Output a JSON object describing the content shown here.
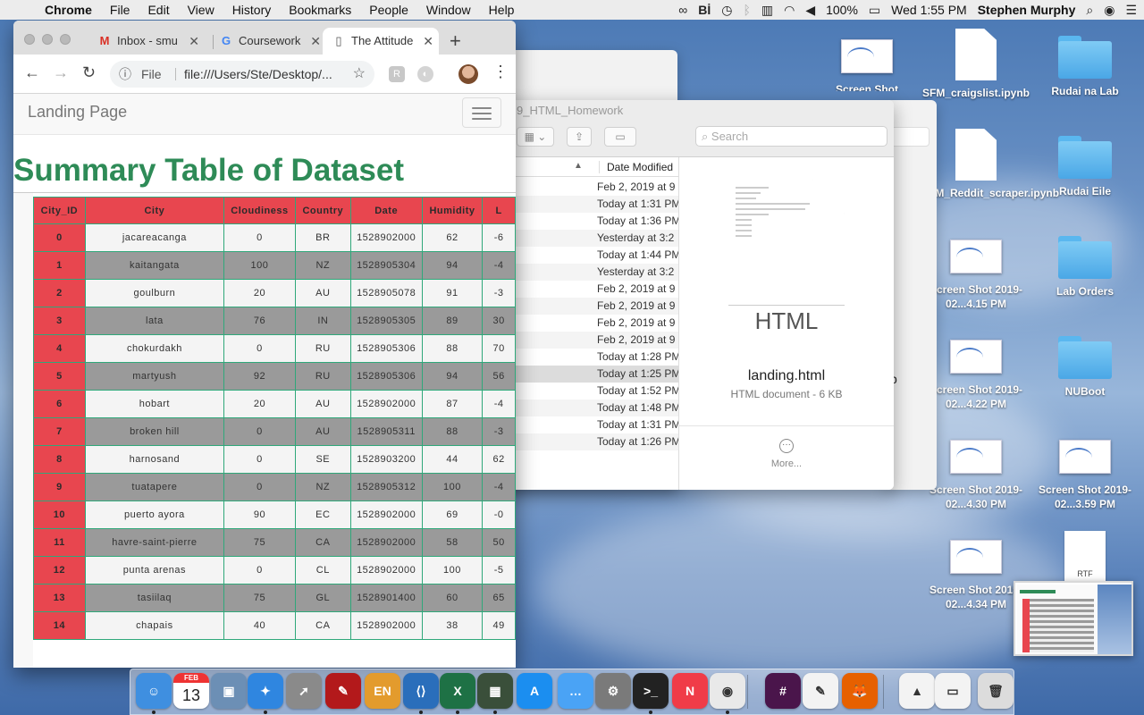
{
  "menubar": {
    "app": "Chrome",
    "items": [
      "File",
      "Edit",
      "View",
      "History",
      "Bookmarks",
      "People",
      "Window",
      "Help"
    ],
    "battery": "100%",
    "clock": "Wed 1:55 PM",
    "user": "Stephen Murphy"
  },
  "desktop": {
    "icons": [
      {
        "label": "Screen Shot",
        "kind": "screenshot"
      },
      {
        "label": "SFM_craigslist.ipynb",
        "kind": "document"
      },
      {
        "label": "Rudai na Lab",
        "kind": "folder"
      },
      {
        "label": "SFM_Reddit_scraper.ipynb",
        "kind": "document"
      },
      {
        "label": "Rudai Eile",
        "kind": "folder"
      },
      {
        "label": "Screen Shot 2019-02...4.15 PM",
        "kind": "screenshot"
      },
      {
        "label": "Lab Orders",
        "kind": "folder"
      },
      {
        "label": "Screen Shot 2019-02...4.22 PM",
        "kind": "screenshot"
      },
      {
        "label": "NUBoot",
        "kind": "folder"
      },
      {
        "label": "Screen Shot 2019-02...4.30 PM",
        "kind": "screenshot"
      },
      {
        "label": "Screen Shot 2019-02...3.59 PM",
        "kind": "screenshot"
      },
      {
        "label": "Screen Shot 2019-02...4.34 PM",
        "kind": "screenshot"
      },
      {
        "label": "RTF",
        "kind": "rtf"
      }
    ]
  },
  "finder": {
    "title": "9_HTML_Homework",
    "search_placeholder": "Search",
    "column_header": "Date Modified",
    "dates": [
      "Feb 2, 2019 at 9",
      "Today at 1:31 PM",
      "Today at 1:36 PM",
      "Yesterday at 3:2",
      "Today at 1:44 PM",
      "Yesterday at 3:2",
      "Feb 2, 2019 at 9",
      "Feb 2, 2019 at 9",
      "Feb 2, 2019 at 9",
      "Feb 2, 2019 at 9",
      "Today at 1:28 PM",
      "Today at 1:25 PM",
      "Today at 1:52 PM",
      "Today at 1:48 PM",
      "Today at 1:31 PM",
      "Today at 1:26 PM"
    ],
    "preview": {
      "doc_label": "HTML",
      "file_name": "landing.html",
      "file_kind": "HTML document - 6 KB",
      "more_label": "More..."
    },
    "behind_letter": "p"
  },
  "chrome": {
    "tabs": [
      {
        "label": "Inbox - smu",
        "icon": "gmail-icon",
        "glyph": "M",
        "color": "#d93025"
      },
      {
        "label": "Coursework",
        "icon": "google-icon",
        "glyph": "G",
        "color": "#4285f4"
      },
      {
        "label": "The Attitude",
        "icon": "document-icon",
        "glyph": "▯",
        "color": "#555555"
      }
    ],
    "omnibox": {
      "scheme": "File",
      "url": "file:///Users/Ste/Desktop/..."
    }
  },
  "page": {
    "brand": "Landing Page",
    "heading": "Summary Table of Dataset",
    "table": {
      "headers": [
        "City_ID",
        "City",
        "Cloudiness",
        "Country",
        "Date",
        "Humidity",
        "L"
      ],
      "rows": [
        [
          "0",
          "jacareacanga",
          "0",
          "BR",
          "1528902000",
          "62",
          "-6"
        ],
        [
          "1",
          "kaitangata",
          "100",
          "NZ",
          "1528905304",
          "94",
          "-4"
        ],
        [
          "2",
          "goulburn",
          "20",
          "AU",
          "1528905078",
          "91",
          "-3"
        ],
        [
          "3",
          "lata",
          "76",
          "IN",
          "1528905305",
          "89",
          "30"
        ],
        [
          "4",
          "chokurdakh",
          "0",
          "RU",
          "1528905306",
          "88",
          "70"
        ],
        [
          "5",
          "martyush",
          "92",
          "RU",
          "1528905306",
          "94",
          "56"
        ],
        [
          "6",
          "hobart",
          "20",
          "AU",
          "1528902000",
          "87",
          "-4"
        ],
        [
          "7",
          "broken hill",
          "0",
          "AU",
          "1528905311",
          "88",
          "-3"
        ],
        [
          "8",
          "harnosand",
          "0",
          "SE",
          "1528903200",
          "44",
          "62"
        ],
        [
          "9",
          "tuatapere",
          "0",
          "NZ",
          "1528905312",
          "100",
          "-4"
        ],
        [
          "10",
          "puerto ayora",
          "90",
          "EC",
          "1528902000",
          "69",
          "-0"
        ],
        [
          "11",
          "havre-saint-pierre",
          "75",
          "CA",
          "1528902000",
          "58",
          "50"
        ],
        [
          "12",
          "punta arenas",
          "0",
          "CL",
          "1528902000",
          "100",
          "-5"
        ],
        [
          "13",
          "tasiilaq",
          "75",
          "GL",
          "1528901400",
          "60",
          "65"
        ],
        [
          "14",
          "chapais",
          "40",
          "CA",
          "1528902000",
          "38",
          "49"
        ]
      ]
    }
  },
  "dock": {
    "calendar_month": "FEB",
    "calendar_day": "13",
    "apps": [
      {
        "name": "finder-icon",
        "color": "#3f8fe0",
        "glyph": "☺"
      },
      {
        "name": "calendar-icon",
        "color": "#ffffff",
        "glyph": ""
      },
      {
        "name": "preview-icon",
        "color": "#6c8fb5",
        "glyph": "▣"
      },
      {
        "name": "safari-icon",
        "color": "#2f86e0",
        "glyph": "✦"
      },
      {
        "name": "launchpad-icon",
        "color": "#8a8a8a",
        "glyph": "➚"
      },
      {
        "name": "acrobat-icon",
        "color": "#b3191b",
        "glyph": "✎"
      },
      {
        "name": "dictionary-icon",
        "color": "#e39b2d",
        "glyph": "EN"
      },
      {
        "name": "vscode-icon",
        "color": "#2a6ebb",
        "glyph": "⟨⟩"
      },
      {
        "name": "excel-icon",
        "color": "#1e7145",
        "glyph": "X"
      },
      {
        "name": "photo-app-icon",
        "color": "#3a4f3a",
        "glyph": "▦"
      },
      {
        "name": "app-store-icon",
        "color": "#1b8ef0",
        "glyph": "A"
      },
      {
        "name": "messages-icon",
        "color": "#4aa3f5",
        "glyph": "…"
      },
      {
        "name": "system-preferences-icon",
        "color": "#7a7a7a",
        "glyph": "⚙"
      },
      {
        "name": "terminal-icon",
        "color": "#222222",
        "glyph": ">_"
      },
      {
        "name": "news-icon",
        "color": "#f03c48",
        "glyph": "N"
      },
      {
        "name": "chrome-icon",
        "color": "#e9e9e9",
        "glyph": "◉"
      },
      {
        "name": "slack-icon",
        "color": "#4a154b",
        "glyph": "#"
      },
      {
        "name": "textedit-icon",
        "color": "#f3f3f3",
        "glyph": "✎"
      },
      {
        "name": "firefox-icon",
        "color": "#e66000",
        "glyph": "🦊"
      },
      {
        "name": "vlc-icon",
        "color": "#f3f3f3",
        "glyph": "▲"
      },
      {
        "name": "screen-icon",
        "color": "#f3f3f3",
        "glyph": "▭"
      },
      {
        "name": "trash-icon",
        "color": "#dcdcdc",
        "glyph": "🗑"
      }
    ]
  }
}
